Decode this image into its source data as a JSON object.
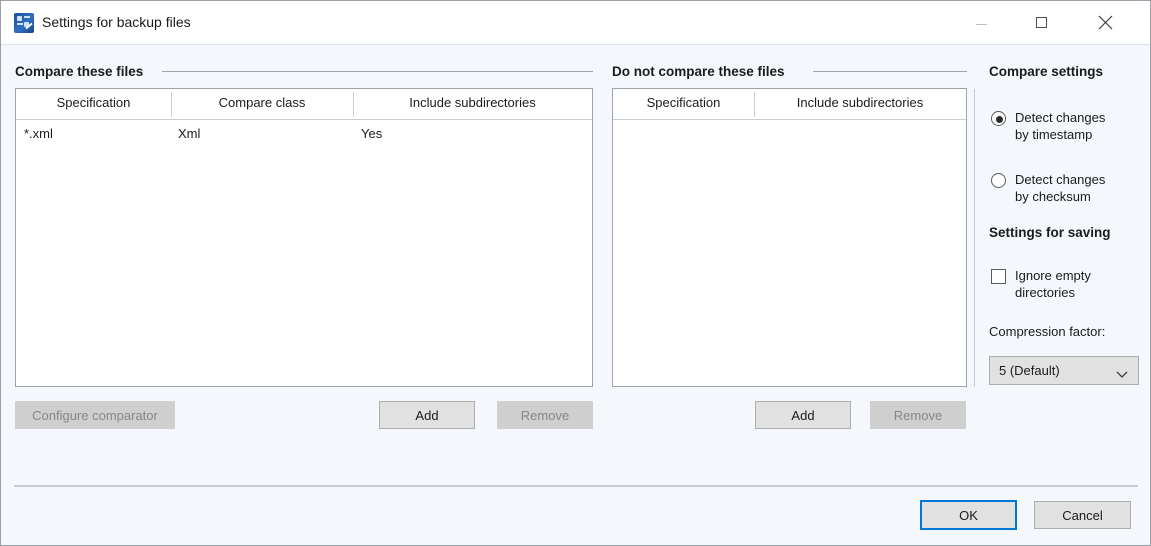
{
  "window": {
    "title": "Settings for backup files",
    "icon": "settings-backup-icon",
    "controls": {
      "minimize": "minimize-icon",
      "maximize": "maximize-icon",
      "close": "close-icon"
    }
  },
  "compare_group": {
    "title": "Compare these files",
    "table": {
      "columns": [
        "Specification",
        "Compare class",
        "Include subdirectories"
      ],
      "rows": [
        [
          "*.xml",
          "Xml",
          "Yes"
        ]
      ]
    },
    "buttons": {
      "configure": {
        "label": "Configure comparator",
        "enabled": false
      },
      "add": {
        "label": "Add",
        "enabled": true
      },
      "remove": {
        "label": "Remove",
        "enabled": false
      }
    }
  },
  "exclude_group": {
    "title": "Do not compare these files",
    "table": {
      "columns": [
        "Specification",
        "Include subdirectories"
      ],
      "rows": []
    },
    "buttons": {
      "add": {
        "label": "Add",
        "enabled": true
      },
      "remove": {
        "label": "Remove",
        "enabled": false
      }
    }
  },
  "compare_settings": {
    "heading": "Compare settings",
    "options": [
      {
        "label_line1": "Detect changes",
        "label_line2": "by timestamp",
        "selected": true
      },
      {
        "label_line1": "Detect changes",
        "label_line2": "by checksum",
        "selected": false
      }
    ]
  },
  "saving_settings": {
    "heading": "Settings for saving",
    "ignore_empty": {
      "label_line1": "Ignore empty",
      "label_line2": "directories",
      "checked": false
    },
    "compression": {
      "label": "Compression factor:",
      "value": "5 (Default)",
      "arrow": "chevron-down-icon"
    }
  },
  "footer": {
    "ok": "OK",
    "cancel": "Cancel"
  },
  "colors": {
    "window_bg": "#f4f7fc",
    "titlebar_bg": "#ffffff",
    "accent": "#0078d7",
    "border": "#9fa4ab",
    "button_face": "#e1e1e1",
    "button_disabled": "#cfcfcf"
  }
}
